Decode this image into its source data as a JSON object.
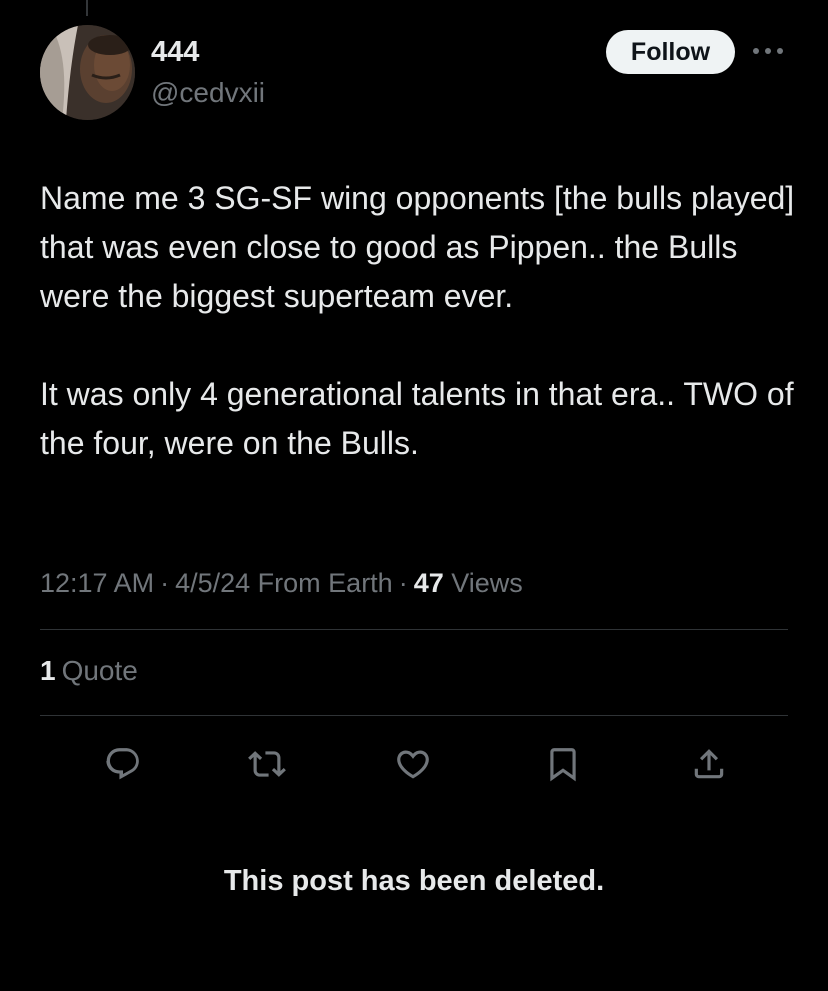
{
  "author": {
    "display_name": "444",
    "handle": "@cedvxii"
  },
  "header": {
    "follow_label": "Follow",
    "more_icon": "ellipsis-icon"
  },
  "post": {
    "paragraphs": [
      "Name me 3 SG-SF wing opponents [the bulls played] that was even close to good as Pippen.. the Bulls were the biggest superteam ever.",
      "It was only 4 generational talents in that era.. TWO of the four, were on the Bulls."
    ],
    "time": "12:17 AM",
    "separator": "·",
    "date": "4/5/24",
    "location": "From Earth",
    "views_count": "47",
    "views_label": "Views"
  },
  "stats": {
    "quote_count": "1",
    "quote_label": "Quote"
  },
  "actions": [
    {
      "icon": "reply-icon"
    },
    {
      "icon": "repost-icon"
    },
    {
      "icon": "like-icon"
    },
    {
      "icon": "bookmark-icon"
    },
    {
      "icon": "share-icon"
    }
  ],
  "notice": "This post has been deleted.",
  "colors": {
    "background": "#000000",
    "text_primary": "#e7e9ea",
    "text_secondary": "#71767b",
    "icon": "#71767b",
    "follow_bg": "#eff3f4",
    "divider": "#2f3336"
  }
}
